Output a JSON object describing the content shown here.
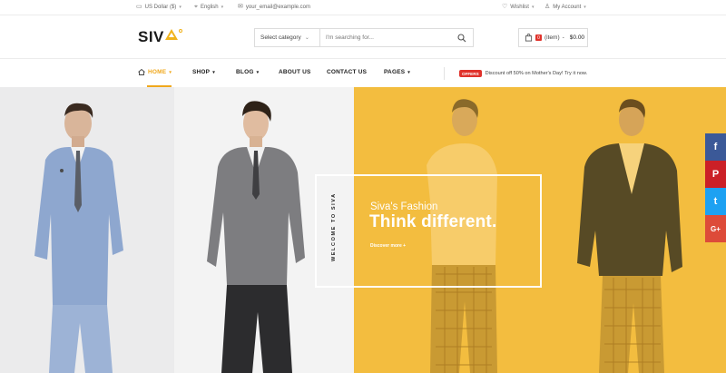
{
  "topbar": {
    "currency": "US Dollar ($)",
    "language": "English",
    "email": "your_email@example.com",
    "wishlist": "Wishlist",
    "account": "My Account"
  },
  "header": {
    "logo_text": "SIV",
    "search": {
      "category": "Select category",
      "placeholder": "I'm searching for..."
    },
    "cart": {
      "count": "0",
      "items_label": "(item)",
      "separator": "-",
      "total": "$0.00"
    }
  },
  "nav": {
    "items": [
      {
        "label": "HOME",
        "active": true
      },
      {
        "label": "SHOP"
      },
      {
        "label": "BLOG"
      },
      {
        "label": "ABOUT US"
      },
      {
        "label": "CONTACT US"
      },
      {
        "label": "PAGES"
      }
    ],
    "offer_tag": "OFFERS",
    "offer_text": "Discount off 50% on Mother's Day! Try it now."
  },
  "hero": {
    "vertical_text": "WELCOME TO SIVA",
    "subtitle": "Siva's Fashion",
    "title": "Think different.",
    "link": "Discover more +"
  },
  "social": [
    {
      "name": "facebook",
      "glyph": "f",
      "color": "#3b5998"
    },
    {
      "name": "pinterest",
      "glyph": "P",
      "color": "#cb2027"
    },
    {
      "name": "twitter",
      "glyph": "t",
      "color": "#1da1f2"
    },
    {
      "name": "google-plus",
      "glyph": "G+",
      "color": "#dd4b39"
    }
  ],
  "colors": {
    "accent": "#f0a81c",
    "hero_yellow": "#f3bd3f",
    "badge_red": "#e0322b"
  }
}
